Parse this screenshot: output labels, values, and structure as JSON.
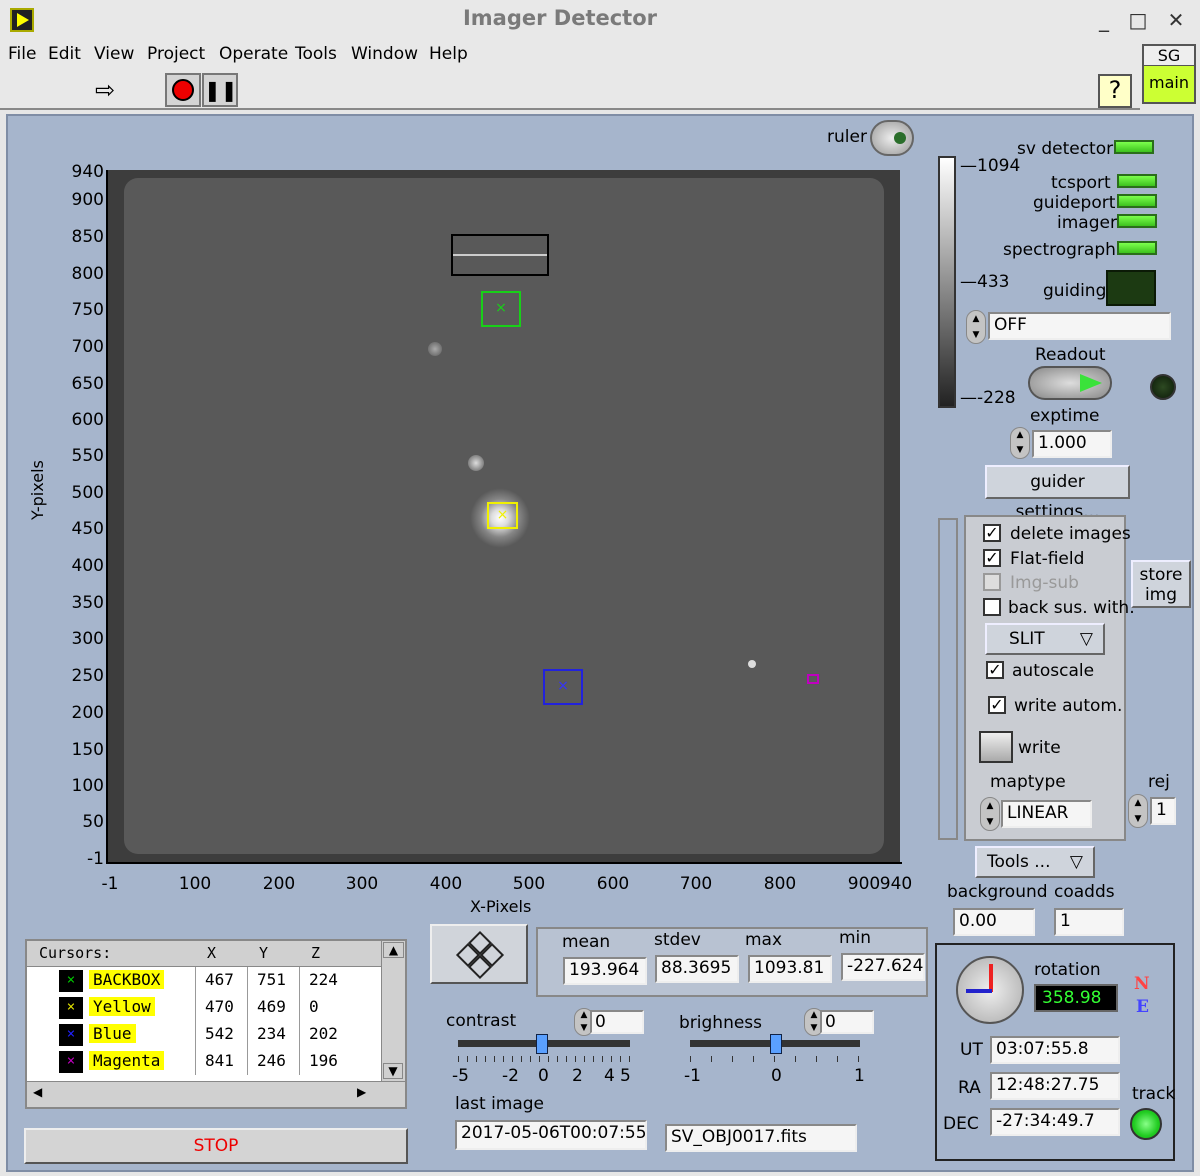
{
  "window": {
    "title": "Imager Detector",
    "minimize": "_",
    "maximize": "□",
    "close": "✕"
  },
  "menu": [
    "File",
    "Edit",
    "View",
    "Project",
    "Operate",
    "Tools",
    "Window",
    "Help"
  ],
  "toolbar": {
    "help": "?",
    "sg": "SG",
    "main": "main"
  },
  "ruler": {
    "label": "ruler"
  },
  "plot": {
    "xlabel": "X-Pixels",
    "ylabel": "Y-pixels",
    "yticks": [
      "940",
      "900",
      "850",
      "800",
      "750",
      "700",
      "650",
      "600",
      "550",
      "500",
      "450",
      "400",
      "350",
      "300",
      "250",
      "200",
      "150",
      "100",
      "50",
      "-1"
    ],
    "xticks": [
      "-1",
      "100",
      "200",
      "300",
      "400",
      "500",
      "600",
      "700",
      "800",
      "900",
      "940"
    ]
  },
  "colorbar": {
    "max": "1094",
    "mid": "433",
    "min": "-228"
  },
  "status": {
    "sv_detector": "sv detector",
    "tcsport": "tcsport",
    "guideport": "guideport",
    "imager": "imager",
    "spectrograph": "spectrograph",
    "guiding": "guiding"
  },
  "guide_mode": "OFF",
  "readout": "Readout",
  "exptime": {
    "label": "exptime",
    "value": "1.000"
  },
  "guider_settings": "guider settings...",
  "options": {
    "delete_images": "delete images",
    "flat_field": "Flat-field",
    "img_sub": "Img-sub",
    "back_sus": "back sus. with:",
    "slit": "SLIT",
    "autoscale": "autoscale",
    "write_autom": "write autom.",
    "write": "write",
    "maptype": "maptype",
    "maptype_value": "LINEAR",
    "store_img": "store img",
    "rej": "rej",
    "rej_value": "1"
  },
  "tools_menu": "Tools ...",
  "background": {
    "label": "background",
    "value": "0.00"
  },
  "coadds": {
    "label": "coadds",
    "value": "1"
  },
  "cursors": {
    "headers": [
      "Cursors:",
      "X",
      "Y",
      "Z"
    ],
    "rows": [
      {
        "name": "BACKBOX",
        "x": "467",
        "y": "751",
        "z": "224",
        "color": "#00c800"
      },
      {
        "name": "Yellow",
        "x": "470",
        "y": "469",
        "z": "0",
        "color": "#e0e000"
      },
      {
        "name": "Blue",
        "x": "542",
        "y": "234",
        "z": "202",
        "color": "#2020ff"
      },
      {
        "name": "Magenta",
        "x": "841",
        "y": "246",
        "z": "196",
        "color": "#c000c0"
      }
    ]
  },
  "stop": "STOP",
  "stats": {
    "labels": [
      "mean",
      "stdev",
      "max",
      "min"
    ],
    "values": [
      "193.964",
      "88.3695",
      "1093.81",
      "-227.624"
    ]
  },
  "contrast": {
    "label": "contrast",
    "value": "0",
    "ticks": [
      "-5",
      "-2",
      "0",
      "2",
      "4",
      "5"
    ]
  },
  "brighness": {
    "label": "brighness",
    "value": "0",
    "ticks": [
      "-1",
      "0",
      "1"
    ]
  },
  "last_image": {
    "label": "last image",
    "time": "2017-05-06T00:07:55",
    "file": "SV_OBJ0017.fits"
  },
  "rotation": {
    "label": "rotation",
    "value": "358.98",
    "N": "N",
    "E": "E"
  },
  "ut": {
    "label": "UT",
    "value": "03:07:55.8"
  },
  "ra": {
    "label": "RA",
    "value": "12:48:27.75"
  },
  "dec": {
    "label": "DEC",
    "value": "-27:34:49.7"
  },
  "track": "track"
}
